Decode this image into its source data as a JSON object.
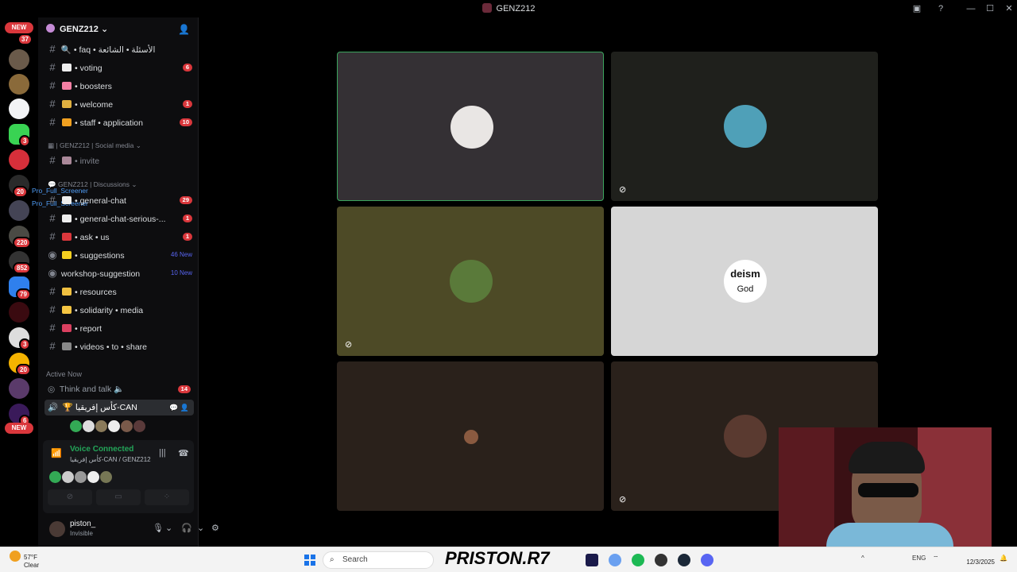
{
  "window": {
    "title": "GENZ212",
    "controls": [
      "inbox-icon",
      "help-icon",
      "minimize",
      "maximize",
      "close"
    ]
  },
  "rail": {
    "badges": [
      "37",
      "3",
      "20",
      "220",
      "852",
      "79",
      "3",
      "20",
      "6"
    ],
    "new_labels": [
      "NEW",
      "NEW"
    ]
  },
  "server": {
    "name": "GENZ212",
    "channels": [
      {
        "name": "faq • الأسئلة • الشائعة",
        "prefix": "🔍 •",
        "count": ""
      },
      {
        "name": "voting",
        "prefix": "•",
        "count": "6"
      },
      {
        "name": "boosters",
        "prefix": "•",
        "count": ""
      },
      {
        "name": "welcome",
        "prefix": "•",
        "count": "1"
      },
      {
        "name": "staff • application",
        "prefix": "•",
        "count": "10"
      }
    ],
    "category_social": "| GENZ212 | Social media",
    "invite_channel": "invite",
    "category_discussions": "GENZ212 | Discussions",
    "overlay_names": [
      "Pro_Full_Screener",
      "Pro_Full_Screener"
    ],
    "discussion_channels": [
      {
        "name": "general-chat",
        "count": "29",
        "new": ""
      },
      {
        "name": "general-chat-serious-...",
        "count": "1",
        "new": ""
      },
      {
        "name": "ask • us",
        "count": "1",
        "new": ""
      },
      {
        "name": "suggestions",
        "count": "",
        "new": "46 New"
      },
      {
        "name": "workshop-suggestion",
        "count": "",
        "new": "10 New"
      },
      {
        "name": "resources",
        "count": "",
        "new": ""
      },
      {
        "name": "solidarity • media",
        "count": "",
        "new": ""
      },
      {
        "name": "report",
        "count": "",
        "new": ""
      },
      {
        "name": "videos • to • share",
        "count": "",
        "new": ""
      }
    ],
    "active_now": "Active Now",
    "voice_channels": [
      {
        "name": "Think and talk",
        "count": "14"
      },
      {
        "name": "كأس إفريقيا-CAN",
        "count": ""
      }
    ]
  },
  "voice": {
    "status": "Voice Connected",
    "location": "كأس إفريقيا-CAN / GENZ212"
  },
  "user": {
    "name": "piston_",
    "status": "Invisible"
  },
  "stage": {
    "tiles": [
      {
        "bg": "#343034",
        "pic": "#e9e6e4",
        "muted": false,
        "speaking": true
      },
      {
        "bg": "#1f201c",
        "pic": "#4fa0b8",
        "muted": true,
        "speaking": false
      },
      {
        "bg": "#4d4a26",
        "pic": "#5a7a3a",
        "muted": true,
        "speaking": false
      },
      {
        "bg": "#d6d6d6",
        "pic": "#ffffff",
        "muted": false,
        "speaking": false,
        "pic_text": "deism"
      },
      {
        "bg": "#2a211b",
        "pic": "#8a5a40",
        "muted": false,
        "speaking": false
      },
      {
        "bg": "#2a211b",
        "pic": "#5a3a30",
        "muted": true,
        "speaking": false
      }
    ],
    "tile_label": "God"
  },
  "taskbar": {
    "temp": "57°F",
    "condition": "Clear",
    "search_placeholder": "Search",
    "brand": "PRISTON.R7",
    "lang": "ENG",
    "date": "12/3/2025"
  },
  "colors": {
    "accent": "#5865f2",
    "danger": "#da373c",
    "connected": "#23a559",
    "speaking_ring": "#3ba55d"
  }
}
